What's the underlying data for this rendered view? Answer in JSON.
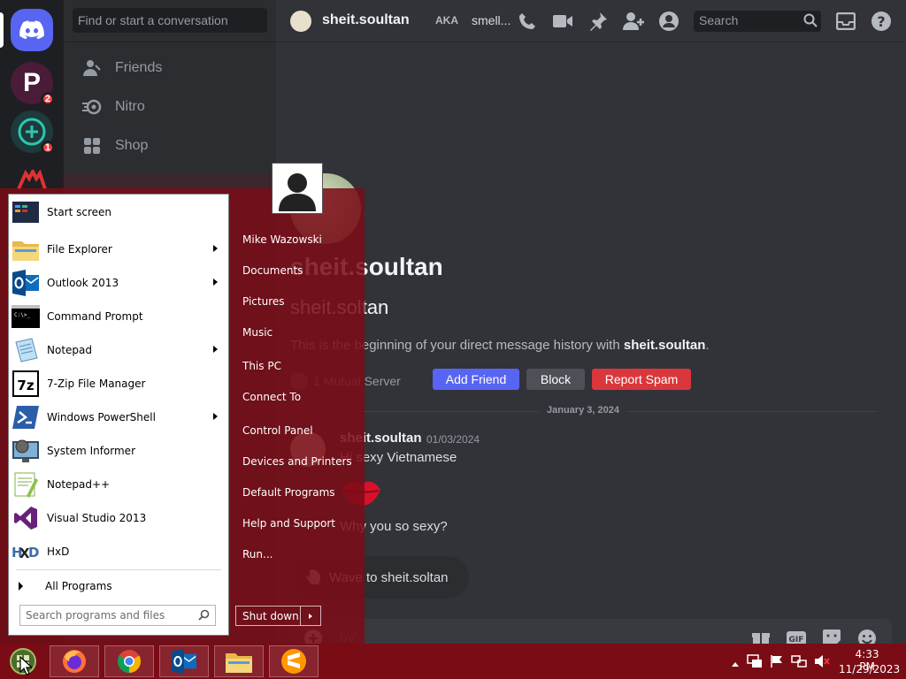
{
  "discord": {
    "guilds": [
      {
        "name": "home",
        "badge": ""
      },
      {
        "name": "server-p",
        "badge": "2"
      },
      {
        "name": "server-plus",
        "badge": "1"
      },
      {
        "name": "server-red",
        "badge": ""
      }
    ],
    "dm_sidebar": {
      "search_placeholder": "Find or start a conversation",
      "nav": [
        {
          "label": "Friends",
          "icon": "friends-icon"
        },
        {
          "label": "Nitro",
          "icon": "nitro-icon"
        },
        {
          "label": "Shop",
          "icon": "shop-icon"
        }
      ]
    },
    "header": {
      "username": "sheit.soultan",
      "aka_label": "AKA",
      "nickname": "smell...",
      "search_placeholder": "Search"
    },
    "intro": {
      "display_name": "sheit.soultan",
      "username": "sheit.soltan",
      "text_prefix": "This is the beginning of your direct message history with ",
      "text_name": "sheit.soultan",
      "text_suffix": ".",
      "mutual": "1 Mutual Server",
      "add_friend": "Add Friend",
      "block": "Block",
      "report_spam": "Report Spam"
    },
    "date_divider": "January 3, 2024",
    "message": {
      "author": "sheit.soultan",
      "timestamp": "01/03/2024",
      "line1": "Hi sexy Vietnamese",
      "line2": "Why you so sexy?"
    },
    "wave_label": "Wave to sheit.soltan",
    "composer_placeholder": "bV"
  },
  "start_menu": {
    "programs": [
      {
        "label": "Start screen",
        "arrow": false
      },
      {
        "label": "File Explorer",
        "arrow": true
      },
      {
        "label": "Outlook 2013",
        "arrow": true
      },
      {
        "label": "Command Prompt",
        "arrow": false
      },
      {
        "label": "Notepad",
        "arrow": true
      },
      {
        "label": "7-Zip File Manager",
        "arrow": false
      },
      {
        "label": "Windows PowerShell",
        "arrow": true
      },
      {
        "label": "System Informer",
        "arrow": false
      },
      {
        "label": "Notepad++",
        "arrow": false
      },
      {
        "label": "Visual Studio 2013",
        "arrow": false
      },
      {
        "label": "HxD",
        "arrow": false
      }
    ],
    "all_programs": "All Programs",
    "search_placeholder": "Search programs and files",
    "places": [
      "Mike Wazowski",
      "Documents",
      "Pictures",
      "Music",
      "This PC",
      "Connect To",
      "Control Panel",
      "Devices and Printers",
      "Default Programs",
      "Help and Support",
      "Run..."
    ],
    "shutdown": "Shut down"
  },
  "taskbar": {
    "apps": [
      "firefox",
      "chrome",
      "outlook",
      "file-explorer",
      "sublime-text"
    ],
    "time": "4:33 PM",
    "date": "11/29/2023"
  },
  "colors": {
    "accent_blurple": "#5865f2",
    "danger_red": "#da373c",
    "taskbar_red": "#7a0c16"
  }
}
